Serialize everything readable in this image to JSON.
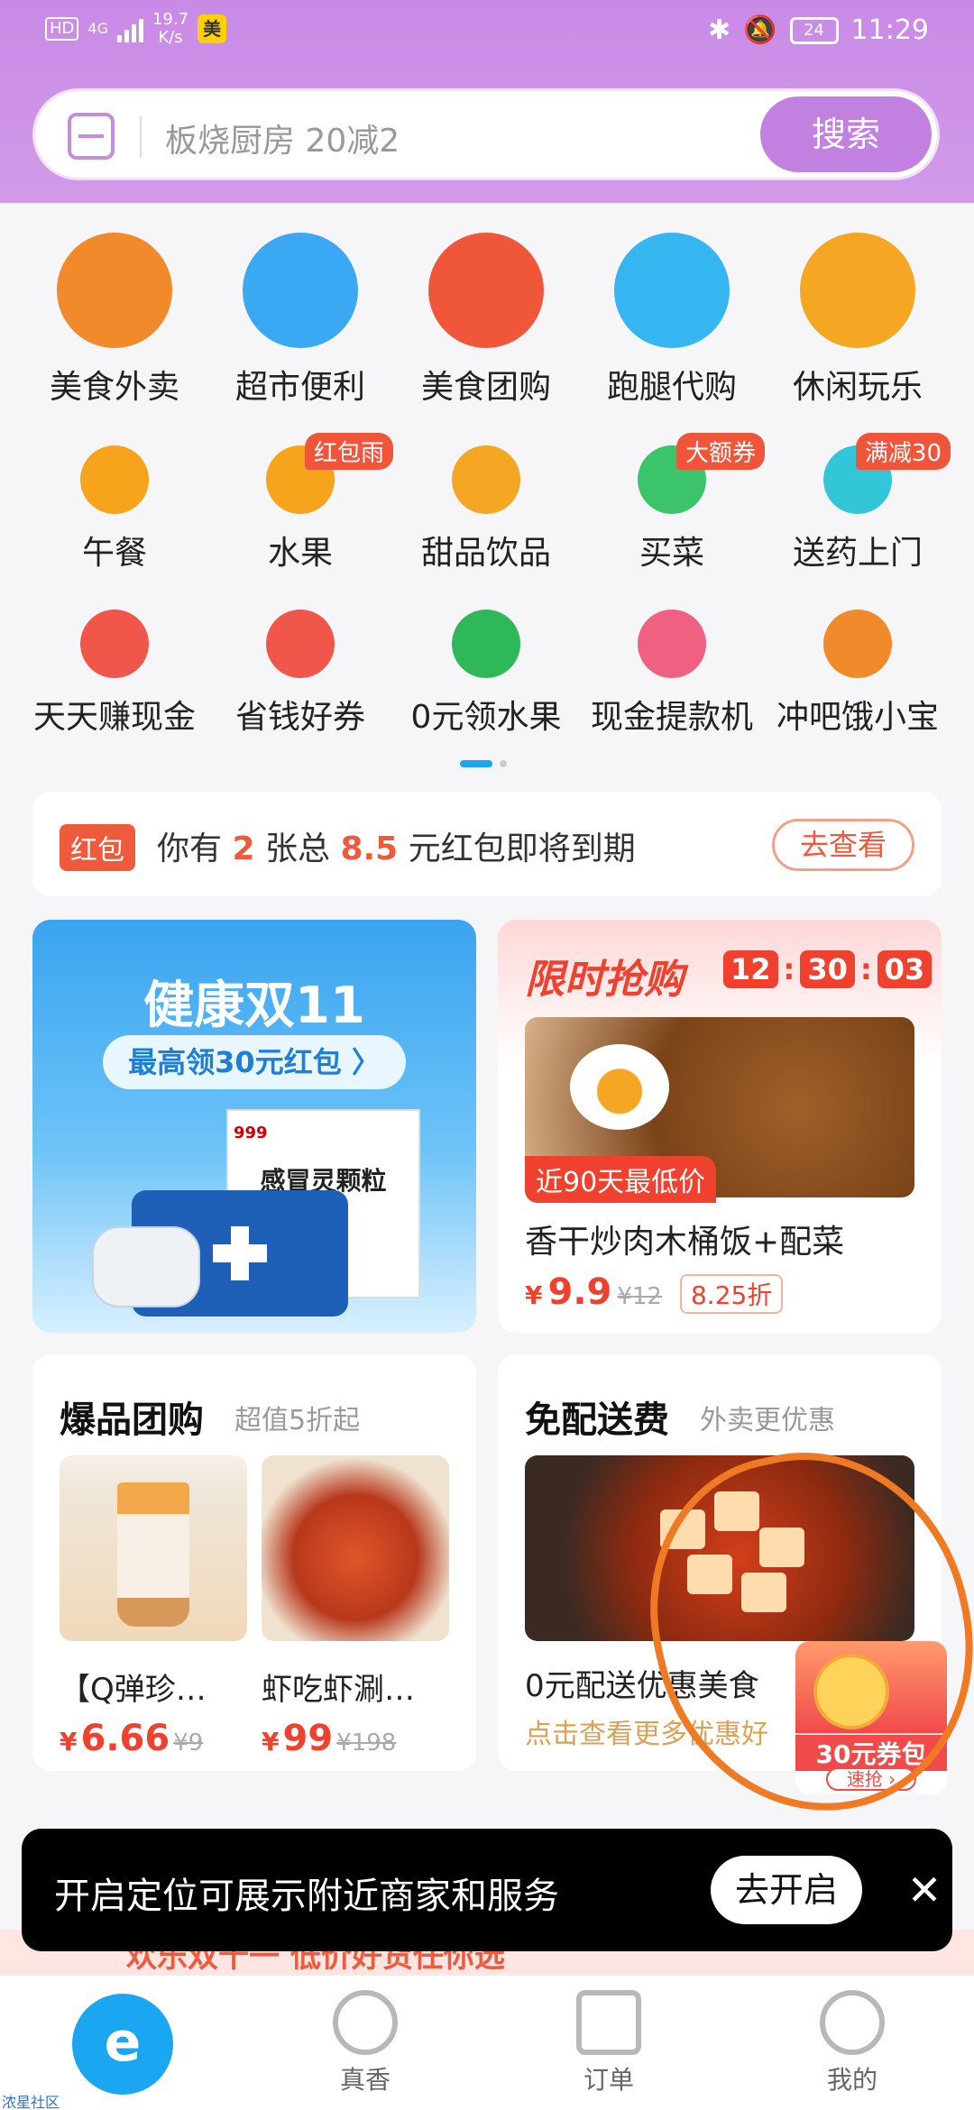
{
  "status_bar": {
    "network": "4G",
    "speed_value": "19.7",
    "speed_unit": "K/s",
    "app_badge": "美",
    "battery": "24",
    "time": "11:29"
  },
  "search": {
    "placeholder": "板烧厨房 20减2",
    "button": "搜索"
  },
  "categories_main": [
    {
      "label": "美食外卖",
      "color": "#f08a2a"
    },
    {
      "label": "超市便利",
      "color": "#3aa8f2"
    },
    {
      "label": "美食团购",
      "color": "#f0563a"
    },
    {
      "label": "跑腿代购",
      "color": "#35b6f0"
    },
    {
      "label": "休闲玩乐",
      "color": "#f5a623"
    }
  ],
  "categories_row2": [
    {
      "label": "午餐",
      "tag": "",
      "color": "#f7a31c"
    },
    {
      "label": "水果",
      "tag": "红包雨",
      "color": "#f7a31c"
    },
    {
      "label": "甜品饮品",
      "tag": "",
      "color": "#f5a623"
    },
    {
      "label": "买菜",
      "tag": "大额券",
      "color": "#3cc46a"
    },
    {
      "label": "送药上门",
      "tag": "满减30",
      "color": "#33c6d8"
    }
  ],
  "categories_row3": [
    {
      "label": "天天赚现金",
      "color": "#f0564a"
    },
    {
      "label": "省钱好券",
      "color": "#f0564a"
    },
    {
      "label": "0元领水果",
      "color": "#2fb85a"
    },
    {
      "label": "现金提款机",
      "color": "#f06080"
    },
    {
      "label": "冲吧饿小宝",
      "color": "#f08a2a"
    }
  ],
  "red_packet": {
    "tag": "红包",
    "msg_pre": "你有",
    "count": "2",
    "msg_mid": "张总",
    "amount": "8.5",
    "msg_post": "元红包即将到期",
    "button": "去查看"
  },
  "health_banner": {
    "title": "健康双11",
    "subtitle": "最高领30元红包 〉",
    "box_brand": "999",
    "box_label": "感冒灵颗粒"
  },
  "flash_sale": {
    "title": "限时抢购",
    "timer": [
      "12",
      "30",
      "03"
    ],
    "badge": "近90天最低价",
    "name": "香干炒肉木桶饭+配菜",
    "currency": "¥",
    "price": "9.9",
    "old_price": "¥12",
    "discount": "8.25折"
  },
  "group_buy": {
    "title": "爆品团购",
    "subtitle": "超值5折起",
    "products": [
      {
        "name": "【Q弹珍…",
        "currency": "¥",
        "price": "6.66",
        "old_price": "¥9"
      },
      {
        "name": "虾吃虾涮…",
        "currency": "¥",
        "price": "99",
        "old_price": "¥198"
      }
    ]
  },
  "free_delivery": {
    "title": "免配送费",
    "subtitle": "外卖更优惠",
    "name": "0元配送优惠美食",
    "link": "点击查看更多优惠好"
  },
  "coupon": {
    "label": "30元券包",
    "button": "速抢 ›"
  },
  "promo_strip": "欢乐双十一 低价好货任你选",
  "toast": {
    "text": "开启定位可展示附近商家和服务",
    "button": "去开启",
    "close": "✕"
  },
  "bottom_nav": [
    {
      "label": "",
      "icon": "home-icon"
    },
    {
      "label": "真香",
      "icon": "zhenxiang-icon"
    },
    {
      "label": "订单",
      "icon": "orders-icon"
    },
    {
      "label": "我的",
      "icon": "profile-icon"
    }
  ],
  "watermark": "浓星社区"
}
